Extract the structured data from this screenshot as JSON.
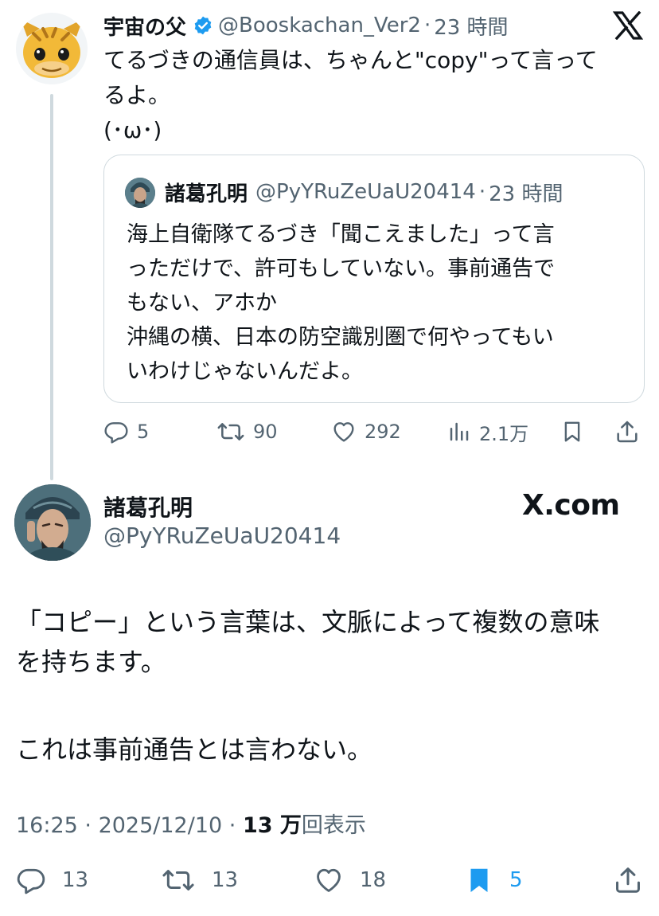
{
  "parent": {
    "name": "宇宙の父",
    "handle": "@Booskachan_Ver2",
    "dot": "·",
    "time": "23 時間",
    "text_lines": [
      "てるづきの通信員は、ちゃんと\"copy\"って言って",
      "るよ。",
      "(･ω･)"
    ],
    "quote": {
      "name": "諸葛孔明",
      "handle": "@PyYRuZeUaU20414",
      "dot": "·",
      "time": "23 時間",
      "text_lines": [
        "海上自衛隊てるづき「聞こえました」って言",
        "っただけで、許可もしていない。事前通告で",
        "もない、アホか",
        "沖縄の横、日本の防空識別圏で何やってもい",
        "いわけじゃないんだよ。"
      ]
    },
    "actions": {
      "replies": "5",
      "reposts": "90",
      "likes": "292",
      "views": "2.1万"
    }
  },
  "main": {
    "name": "諸葛孔明",
    "handle": "@PyYRuZeUaU20414",
    "watermark": "X.com",
    "text_lines": [
      "「コピー」という言葉は、文脈によって複数の意味",
      "を持ちます。"
    ],
    "text_line2": "これは事前通告とは言わない。",
    "meta": {
      "time": "16:25",
      "sep": " · ",
      "date": "2025/12/10",
      "sep2": " · ",
      "views": "13 万",
      "views_label": "回表示"
    },
    "actions": {
      "replies": "13",
      "reposts": "13",
      "likes": "18",
      "bookmarks": "5"
    }
  },
  "colors": {
    "text": "#0f1419",
    "secondary": "#536471",
    "accent": "#1d9bf0",
    "border": "#cfd9de"
  },
  "icons": [
    "x-logo-icon",
    "verified-badge-icon",
    "reply-icon",
    "repost-icon",
    "like-icon",
    "views-icon",
    "bookmark-icon",
    "share-icon"
  ]
}
